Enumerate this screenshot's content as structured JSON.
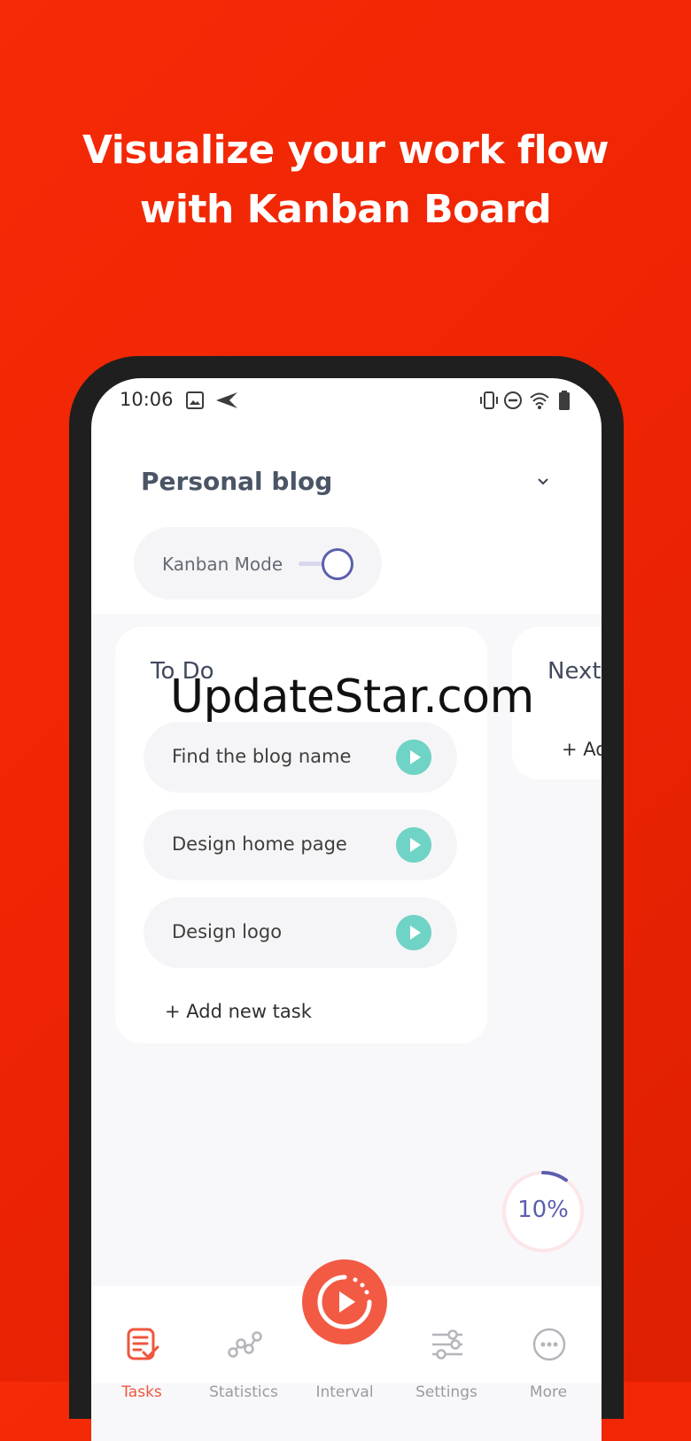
{
  "headline": {
    "line1": "Visualize your work flow",
    "line2": "with Kanban Board"
  },
  "status_bar": {
    "time": "10:06",
    "icons": [
      "image-icon",
      "send-icon",
      "vibrate-icon",
      "do-not-disturb-icon",
      "wifi-icon",
      "battery-icon"
    ]
  },
  "project": {
    "title": "Personal blog"
  },
  "kanban_mode": {
    "label": "Kanban Mode",
    "enabled": true
  },
  "columns": [
    {
      "title": "To Do",
      "tasks": [
        {
          "label": "Find the blog name"
        },
        {
          "label": "Design home page"
        },
        {
          "label": "Design logo"
        }
      ],
      "add_label": "+ Add new task"
    },
    {
      "title": "Next",
      "add_label": "+ Ad"
    }
  ],
  "watermark": "UpdateStar.com",
  "progress": {
    "label": "10%",
    "value": 0.1
  },
  "bottom_nav": {
    "items": [
      {
        "label": "Tasks",
        "icon": "tasks-icon",
        "active": true
      },
      {
        "label": "Statistics",
        "icon": "statistics-icon"
      },
      {
        "label": "Interval",
        "icon": "play-timer-icon"
      },
      {
        "label": "Settings",
        "icon": "sliders-icon"
      },
      {
        "label": "More",
        "icon": "more-icon"
      }
    ]
  },
  "colors": {
    "background": "#ee2404",
    "accent": "#5b5fad",
    "play": "#6fd3c6",
    "fab": "#f25a44"
  }
}
